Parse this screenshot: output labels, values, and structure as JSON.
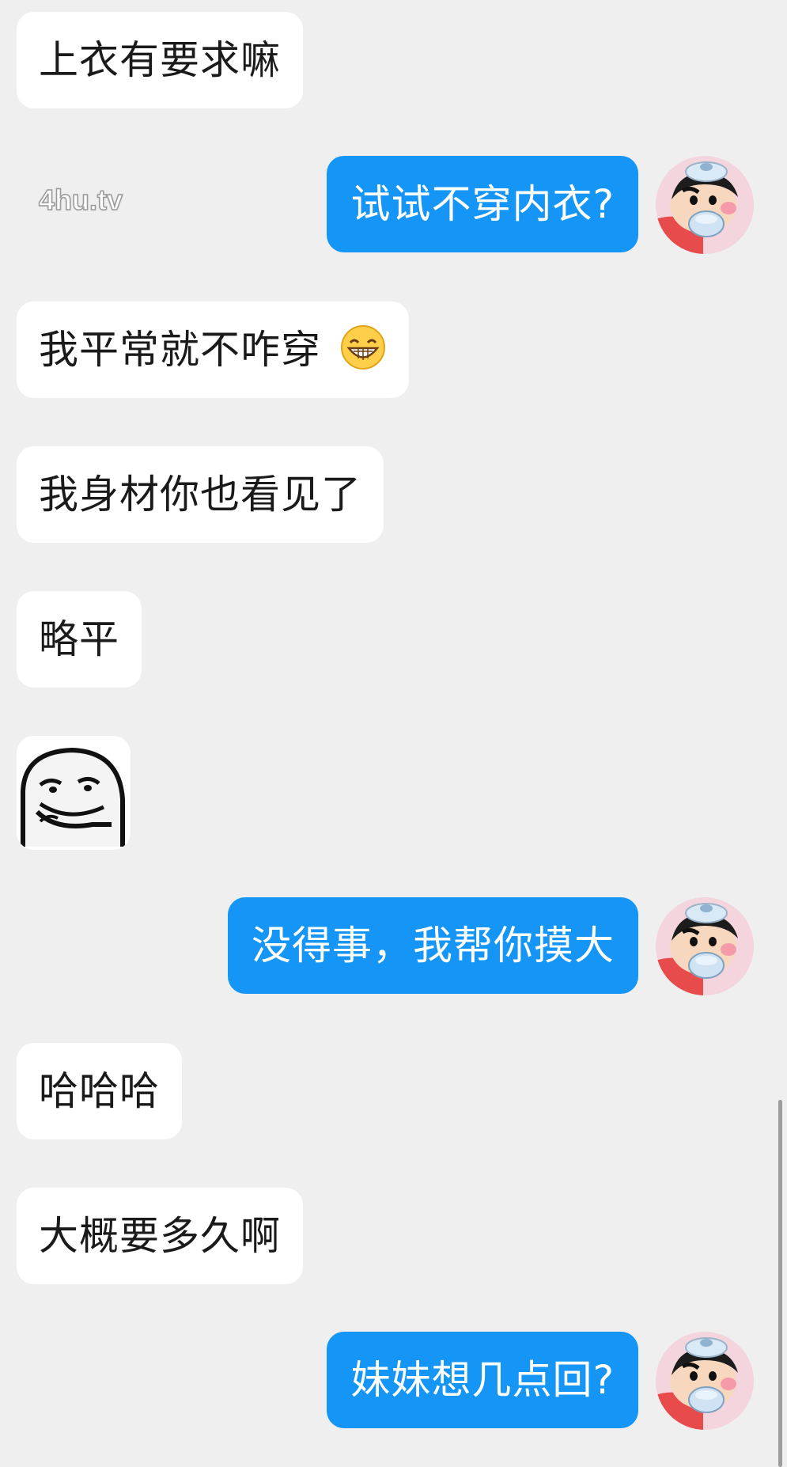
{
  "messages": [
    {
      "side": "in",
      "text": "上衣有要求嘛"
    },
    {
      "side": "out",
      "text": "试试不穿内衣?"
    },
    {
      "side": "in",
      "text": "我平常就不咋穿",
      "emoji": "grin-emoji"
    },
    {
      "side": "in",
      "text": "我身材你也看见了"
    },
    {
      "side": "in",
      "text": "略平"
    },
    {
      "side": "in",
      "type": "sticker",
      "sticker": "smug-face-sticker"
    },
    {
      "side": "out",
      "text": "没得事，我帮你摸大"
    },
    {
      "side": "in",
      "text": "哈哈哈"
    },
    {
      "side": "in",
      "text": "大概要多久啊"
    },
    {
      "side": "out",
      "text": "妹妹想几点回?"
    }
  ],
  "watermark": "4hu.tv",
  "colors": {
    "background": "#efefef",
    "incoming_bubble": "#ffffff",
    "outgoing_bubble": "#1596f7",
    "outgoing_text": "#ffffff",
    "incoming_text": "#1a1a1a"
  },
  "avatar": {
    "icon": "crayon-shinchan-avatar"
  }
}
